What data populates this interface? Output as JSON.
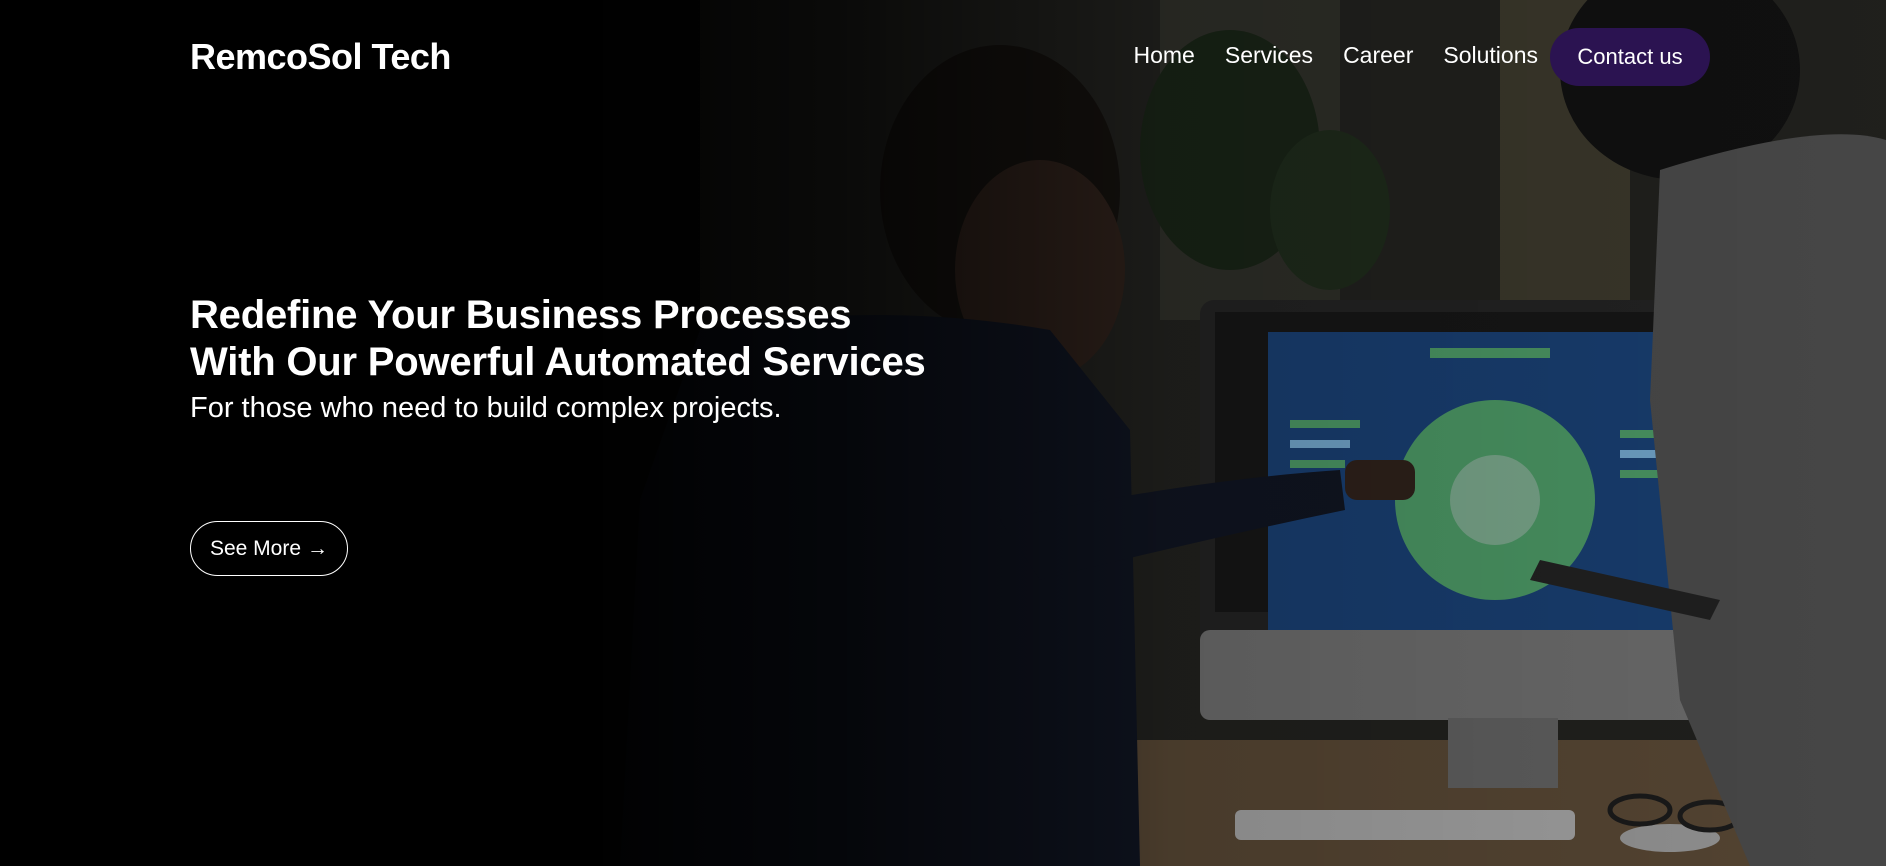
{
  "header": {
    "brand": "RemcoSol Tech",
    "nav": [
      "Home",
      "Services",
      "Career",
      "Solutions"
    ],
    "contact_label": "Contact us"
  },
  "hero": {
    "headline": "Redefine Your Business Processes With Our Powerful Automated Services",
    "subline": "For those who need to build complex projects.",
    "cta_label": "See More",
    "cta_icon": "arrow-right-icon",
    "cta_arrow": "→"
  },
  "colors": {
    "background": "#000000",
    "text": "#ffffff",
    "contact_button": "#2b1351",
    "screen_blue": "#1f4f8f",
    "chart_green": "#5fbf7f"
  }
}
